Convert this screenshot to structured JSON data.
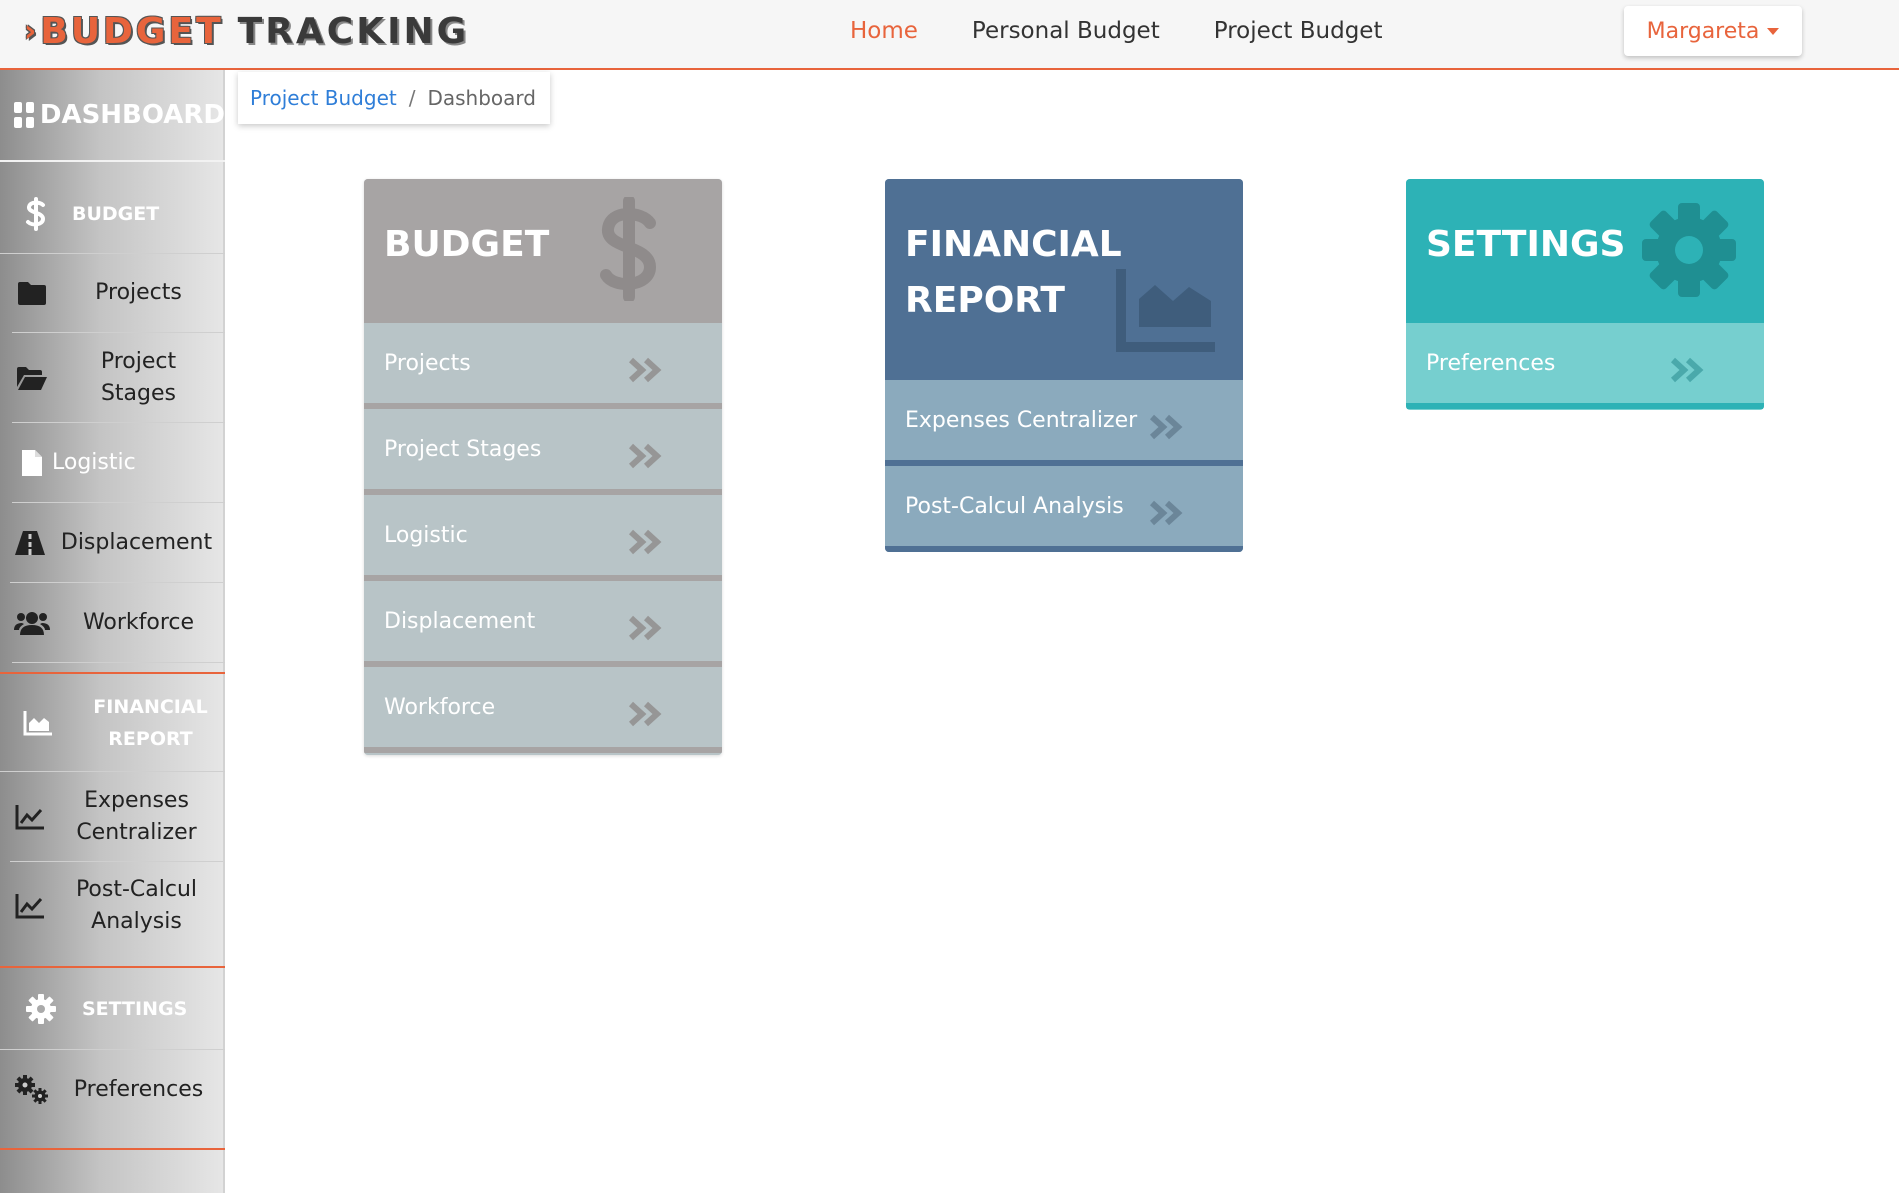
{
  "header": {
    "brand_prefix": "›",
    "brand_word1": "BUDGET",
    "brand_word2": "TRACKING",
    "nav": [
      "Home",
      "Personal Budget",
      "Project Budget"
    ],
    "user": "Margareta"
  },
  "sidebar": {
    "dashboard": "DASHBOARD",
    "budget_section": "BUDGET",
    "budget_items": [
      "Projects",
      "Project Stages",
      "Logistic",
      "Displacement",
      "Workforce"
    ],
    "financial_section": "FINANCIAL REPORT",
    "financial_items": [
      "Expenses Centralizer",
      "Post-Calcul Analysis"
    ],
    "settings_section": "SETTINGS",
    "settings_items": [
      "Preferences"
    ]
  },
  "breadcrumb": {
    "parent": "Project Budget",
    "current": "Dashboard"
  },
  "cards": {
    "budget": {
      "title": "BUDGET",
      "icon": "dollar-icon",
      "items": [
        "Projects",
        "Project Stages",
        "Logistic",
        "Displacement",
        "Workforce"
      ]
    },
    "financial": {
      "title_line1": "FINANCIAL",
      "title_line2": "REPORT",
      "icon": "area-chart-icon",
      "items": [
        "Expenses Centralizer",
        "Post-Calcul Analysis"
      ]
    },
    "settings": {
      "title": "SETTINGS",
      "icon": "gear-icon",
      "items": [
        "Preferences"
      ]
    }
  },
  "colors": {
    "accent": "#e8643c",
    "link": "#2f7ed8",
    "budget_header": "#a7a4a4",
    "budget_rows": "#b8c4c7",
    "financial_header": "#4f7094",
    "financial_rows": "#8baabd",
    "settings_header": "#2db2b6",
    "settings_rows": "#76cfcf"
  }
}
